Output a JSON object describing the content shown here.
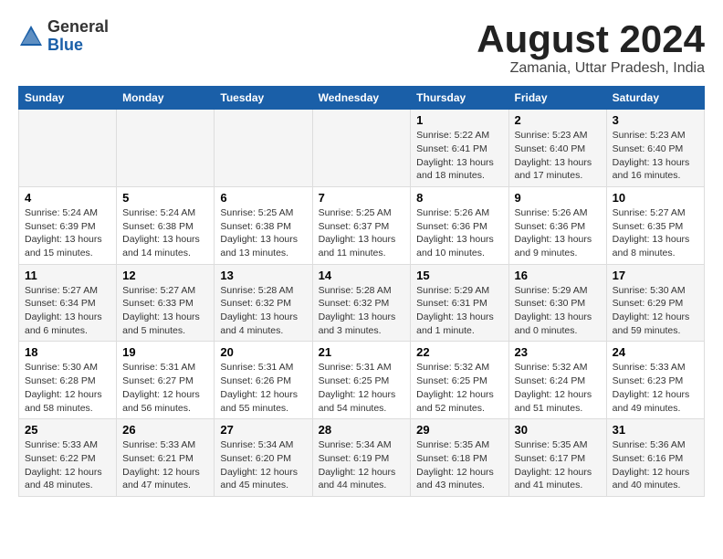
{
  "header": {
    "logo_general": "General",
    "logo_blue": "Blue",
    "month_title": "August 2024",
    "location": "Zamania, Uttar Pradesh, India"
  },
  "days_of_week": [
    "Sunday",
    "Monday",
    "Tuesday",
    "Wednesday",
    "Thursday",
    "Friday",
    "Saturday"
  ],
  "weeks": [
    [
      {
        "day": "",
        "info": ""
      },
      {
        "day": "",
        "info": ""
      },
      {
        "day": "",
        "info": ""
      },
      {
        "day": "",
        "info": ""
      },
      {
        "day": "1",
        "info": "Sunrise: 5:22 AM\nSunset: 6:41 PM\nDaylight: 13 hours\nand 18 minutes."
      },
      {
        "day": "2",
        "info": "Sunrise: 5:23 AM\nSunset: 6:40 PM\nDaylight: 13 hours\nand 17 minutes."
      },
      {
        "day": "3",
        "info": "Sunrise: 5:23 AM\nSunset: 6:40 PM\nDaylight: 13 hours\nand 16 minutes."
      }
    ],
    [
      {
        "day": "4",
        "info": "Sunrise: 5:24 AM\nSunset: 6:39 PM\nDaylight: 13 hours\nand 15 minutes."
      },
      {
        "day": "5",
        "info": "Sunrise: 5:24 AM\nSunset: 6:38 PM\nDaylight: 13 hours\nand 14 minutes."
      },
      {
        "day": "6",
        "info": "Sunrise: 5:25 AM\nSunset: 6:38 PM\nDaylight: 13 hours\nand 13 minutes."
      },
      {
        "day": "7",
        "info": "Sunrise: 5:25 AM\nSunset: 6:37 PM\nDaylight: 13 hours\nand 11 minutes."
      },
      {
        "day": "8",
        "info": "Sunrise: 5:26 AM\nSunset: 6:36 PM\nDaylight: 13 hours\nand 10 minutes."
      },
      {
        "day": "9",
        "info": "Sunrise: 5:26 AM\nSunset: 6:36 PM\nDaylight: 13 hours\nand 9 minutes."
      },
      {
        "day": "10",
        "info": "Sunrise: 5:27 AM\nSunset: 6:35 PM\nDaylight: 13 hours\nand 8 minutes."
      }
    ],
    [
      {
        "day": "11",
        "info": "Sunrise: 5:27 AM\nSunset: 6:34 PM\nDaylight: 13 hours\nand 6 minutes."
      },
      {
        "day": "12",
        "info": "Sunrise: 5:27 AM\nSunset: 6:33 PM\nDaylight: 13 hours\nand 5 minutes."
      },
      {
        "day": "13",
        "info": "Sunrise: 5:28 AM\nSunset: 6:32 PM\nDaylight: 13 hours\nand 4 minutes."
      },
      {
        "day": "14",
        "info": "Sunrise: 5:28 AM\nSunset: 6:32 PM\nDaylight: 13 hours\nand 3 minutes."
      },
      {
        "day": "15",
        "info": "Sunrise: 5:29 AM\nSunset: 6:31 PM\nDaylight: 13 hours\nand 1 minute."
      },
      {
        "day": "16",
        "info": "Sunrise: 5:29 AM\nSunset: 6:30 PM\nDaylight: 13 hours\nand 0 minutes."
      },
      {
        "day": "17",
        "info": "Sunrise: 5:30 AM\nSunset: 6:29 PM\nDaylight: 12 hours\nand 59 minutes."
      }
    ],
    [
      {
        "day": "18",
        "info": "Sunrise: 5:30 AM\nSunset: 6:28 PM\nDaylight: 12 hours\nand 58 minutes."
      },
      {
        "day": "19",
        "info": "Sunrise: 5:31 AM\nSunset: 6:27 PM\nDaylight: 12 hours\nand 56 minutes."
      },
      {
        "day": "20",
        "info": "Sunrise: 5:31 AM\nSunset: 6:26 PM\nDaylight: 12 hours\nand 55 minutes."
      },
      {
        "day": "21",
        "info": "Sunrise: 5:31 AM\nSunset: 6:25 PM\nDaylight: 12 hours\nand 54 minutes."
      },
      {
        "day": "22",
        "info": "Sunrise: 5:32 AM\nSunset: 6:25 PM\nDaylight: 12 hours\nand 52 minutes."
      },
      {
        "day": "23",
        "info": "Sunrise: 5:32 AM\nSunset: 6:24 PM\nDaylight: 12 hours\nand 51 minutes."
      },
      {
        "day": "24",
        "info": "Sunrise: 5:33 AM\nSunset: 6:23 PM\nDaylight: 12 hours\nand 49 minutes."
      }
    ],
    [
      {
        "day": "25",
        "info": "Sunrise: 5:33 AM\nSunset: 6:22 PM\nDaylight: 12 hours\nand 48 minutes."
      },
      {
        "day": "26",
        "info": "Sunrise: 5:33 AM\nSunset: 6:21 PM\nDaylight: 12 hours\nand 47 minutes."
      },
      {
        "day": "27",
        "info": "Sunrise: 5:34 AM\nSunset: 6:20 PM\nDaylight: 12 hours\nand 45 minutes."
      },
      {
        "day": "28",
        "info": "Sunrise: 5:34 AM\nSunset: 6:19 PM\nDaylight: 12 hours\nand 44 minutes."
      },
      {
        "day": "29",
        "info": "Sunrise: 5:35 AM\nSunset: 6:18 PM\nDaylight: 12 hours\nand 43 minutes."
      },
      {
        "day": "30",
        "info": "Sunrise: 5:35 AM\nSunset: 6:17 PM\nDaylight: 12 hours\nand 41 minutes."
      },
      {
        "day": "31",
        "info": "Sunrise: 5:36 AM\nSunset: 6:16 PM\nDaylight: 12 hours\nand 40 minutes."
      }
    ]
  ]
}
